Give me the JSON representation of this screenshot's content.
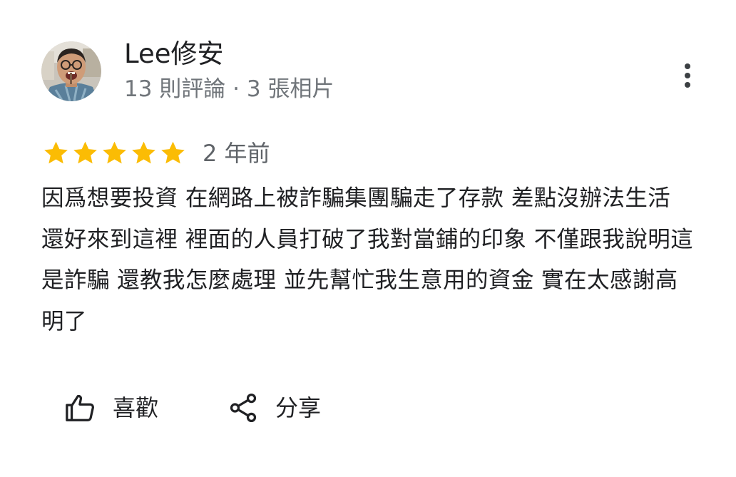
{
  "author": {
    "name": "Lee修安",
    "meta": "13 則評論 · 3 張相片"
  },
  "review": {
    "rating": 5,
    "rating_max": 5,
    "date": "2 年前",
    "text": "因爲想要投資 在網路上被詐騙集團騙走了存款 差點沒辦法生活 還好來到這裡 裡面的人員打破了我對當鋪的印象 不僅跟我說明這是詐騙 還教我怎麼處理 並先幫忙我生意用的資金 實在太感謝高明了"
  },
  "actions": {
    "like_label": "喜歡",
    "share_label": "分享"
  },
  "colors": {
    "star": "#fbbc04",
    "text_primary": "#202124",
    "text_secondary": "#70757a"
  },
  "icons": {
    "more": "more-vert-icon",
    "star": "star-icon",
    "like": "thumb-up-icon",
    "share": "share-icon"
  }
}
